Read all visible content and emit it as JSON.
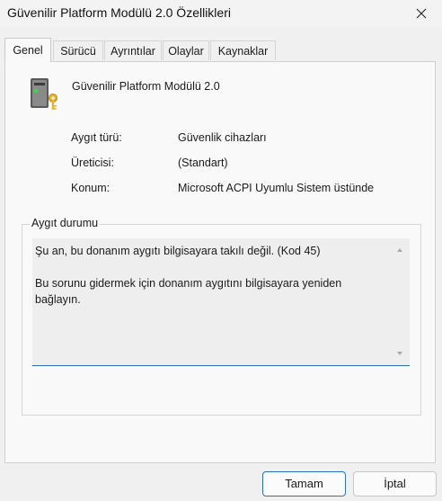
{
  "window": {
    "title": "Güvenilir Platform Modülü 2.0 Özellikleri"
  },
  "tabs": [
    {
      "label": "Genel",
      "active": true
    },
    {
      "label": "Sürücü"
    },
    {
      "label": "Ayrıntılar"
    },
    {
      "label": "Olaylar"
    },
    {
      "label": "Kaynaklar"
    }
  ],
  "device": {
    "name": "Güvenilir Platform Modülü 2.0",
    "icon": "tpm-chip-key-icon"
  },
  "properties": [
    {
      "label": "Aygıt türü:",
      "value": "Güvenlik cihazları"
    },
    {
      "label": "Üreticisi:",
      "value": "(Standart)"
    },
    {
      "label": "Konum:",
      "value": "Microsoft ACPI Uyumlu Sistem üstünde"
    }
  ],
  "status": {
    "legend": "Aygıt durumu",
    "text": "Şu an, bu donanım aygıtı bilgisayara takılı değil. (Kod 45)\n\nBu sorunu gidermek için donanım aygıtını bilgisayara yeniden bağlayın."
  },
  "buttons": {
    "ok": "Tamam",
    "cancel": "İptal"
  },
  "colors": {
    "accent": "#2f6fc0",
    "panel": "#f9f9f9",
    "window": "#f0f0f0"
  }
}
